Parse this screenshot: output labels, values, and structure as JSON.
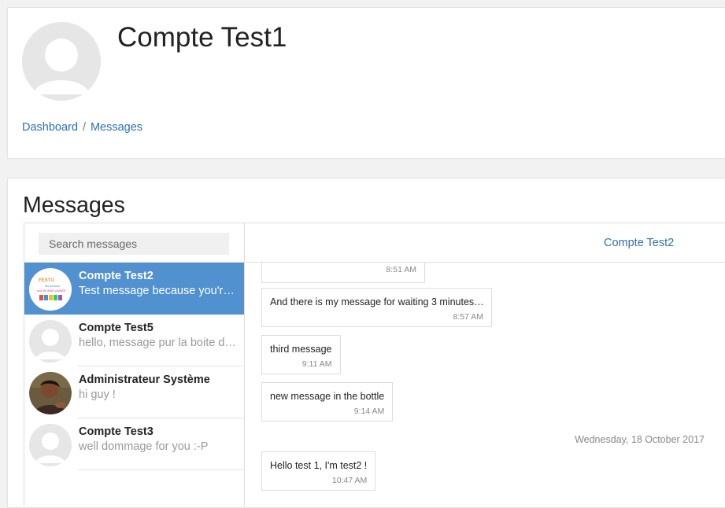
{
  "profile": {
    "name": "Compte Test1"
  },
  "breadcrumb": {
    "dashboard": "Dashboard",
    "separator": "/",
    "messages": "Messages"
  },
  "main": {
    "title": "Messages"
  },
  "search": {
    "placeholder": "Search messages"
  },
  "conversations": [
    {
      "name": "Compte Test2",
      "preview": "Test message because you're there",
      "active": true,
      "avatar": "custom-avatar"
    },
    {
      "name": "Compte Test5",
      "preview": "hello, message pur la boite de reception",
      "active": false,
      "avatar": "default-avatar"
    },
    {
      "name": "Administrateur Système",
      "preview": "hi guy !",
      "active": false,
      "avatar": "photo-avatar"
    },
    {
      "name": "Compte Test3",
      "preview": "well dommage for you :-P",
      "active": false,
      "avatar": "default-avatar"
    }
  ],
  "chat": {
    "contact": "Compte Test2",
    "messages": [
      {
        "text": "",
        "time": "8:51 AM"
      },
      {
        "text": "And there is my message for waiting 3 minutes…",
        "time": "8:57 AM"
      },
      {
        "text": "third message",
        "time": "9:11 AM"
      },
      {
        "text": "new message in the bottle",
        "time": "9:14 AM"
      },
      {
        "text": "Hello test 1, I'm test2 !",
        "time": "10:47 AM"
      }
    ],
    "date_separator": "Wednesday, 18 October 2017"
  },
  "colors": {
    "accent": "#5191cf",
    "link": "#2f6fb5",
    "avatar_bg": "#e6e6e6"
  }
}
